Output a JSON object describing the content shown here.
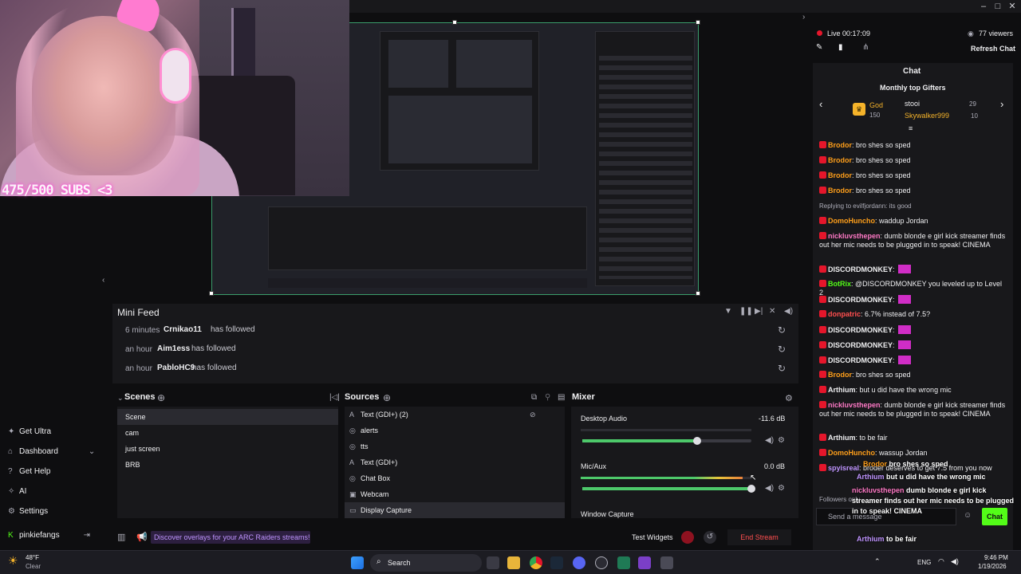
{
  "window": {
    "minimize": "–",
    "maximize": "□",
    "close": "✕"
  },
  "overlay": {
    "sub_goal": "475/500 SUBS <3"
  },
  "mini_feed": {
    "title": "Mini Feed",
    "items": [
      {
        "time": "6 minutes",
        "user": "Crnikao11",
        "action": "has followed"
      },
      {
        "time": "an hour",
        "user": "Aim1ess",
        "action": "has followed"
      },
      {
        "time": "an hour",
        "user": "PabloHC9",
        "action": "has followed"
      }
    ]
  },
  "left_nav": {
    "items": [
      {
        "label": "Get Ultra",
        "icon": "ultra-icon"
      },
      {
        "label": "Dashboard",
        "icon": "dashboard-icon"
      },
      {
        "label": "Get Help",
        "icon": "help-icon"
      },
      {
        "label": "AI",
        "icon": "ai-icon"
      },
      {
        "label": "Settings",
        "icon": "gear-icon"
      }
    ],
    "account": "pinkiefangs"
  },
  "scenes": {
    "title": "Scenes",
    "items": [
      "Scene",
      "cam",
      "just screen",
      "BRB"
    ],
    "active": 0
  },
  "sources": {
    "title": "Sources",
    "items": [
      "Text (GDI+) (2)",
      "alerts",
      "tts",
      "Text (GDI+)",
      "Chat Box",
      "Webcam",
      "Display Capture"
    ],
    "active": 6
  },
  "mixer": {
    "title": "Mixer",
    "channels": [
      {
        "name": "Desktop Audio",
        "db": "-11.6 dB",
        "level": 0.68,
        "meter": 0.0
      },
      {
        "name": "Mic/Aux",
        "db": "0.0 dB",
        "level": 1.0,
        "meter": 0.95
      },
      {
        "name": "Window Capture",
        "db": "",
        "level": 0.0,
        "meter": 0.0
      }
    ]
  },
  "bottom_bar": {
    "promo": "Discover overlays for your ARC Raiders streams!",
    "test_widgets": "Test Widgets",
    "end_stream": "End Stream"
  },
  "stream_status": {
    "live": "Live 00:17:09",
    "viewers": "77 viewers",
    "refresh_chat": "Refresh Chat"
  },
  "chat": {
    "title": "Chat",
    "gifters_title": "Monthly top Gifters",
    "gifters": [
      {
        "name": "God",
        "count": "150"
      },
      {
        "name": "stooi",
        "count": "29"
      },
      {
        "name": "Skywalker999",
        "count": "10"
      }
    ],
    "messages": [
      {
        "user": "Brodor",
        "text": ": bro shes so sped",
        "color": "#ff9f1a"
      },
      {
        "user": "Brodor",
        "text": ": bro shes so sped",
        "color": "#ff9f1a"
      },
      {
        "user": "Brodor",
        "text": ": bro shes so sped",
        "color": "#ff9f1a"
      },
      {
        "user": "Brodor",
        "text": ": bro shes so sped",
        "color": "#ff9f1a"
      },
      {
        "user": "",
        "text": "Replying to evilfjordann: its good",
        "color": "#adadb8"
      },
      {
        "user": "DomoHuncho",
        "text": ": waddup Jordan",
        "color": "#ff9f1a"
      },
      {
        "user": "nickluvsthepen",
        "text": ": dumb blonde e girl kick streamer finds out her mic needs to be plugged in to speak! CINEMA",
        "color": "#ff79c6"
      },
      {
        "user": "DISCORDMONKEY",
        "text": ":",
        "color": "#efeff1"
      },
      {
        "user": "BotRix",
        "text": ": @DISCORDMONKEY you leveled up to Level 2",
        "color": "#53fc18"
      },
      {
        "user": "DISCORDMONKEY",
        "text": ":",
        "color": "#efeff1"
      },
      {
        "user": "donpatric",
        "text": ": 6.7% instead of 7.5?",
        "color": "#ff4f4f"
      },
      {
        "user": "DISCORDMONKEY",
        "text": ":",
        "color": "#efeff1"
      },
      {
        "user": "DISCORDMONKEY",
        "text": ":",
        "color": "#efeff1"
      },
      {
        "user": "DISCORDMONKEY",
        "text": ":",
        "color": "#efeff1"
      },
      {
        "user": "Brodor",
        "text": ": bro shes so sped",
        "color": "#ff9f1a"
      },
      {
        "user": "Arthium",
        "text": ": but u did have the wrong mic",
        "color": "#efeff1"
      },
      {
        "user": "nickluvsthepen",
        "text": ": dumb blonde e girl kick streamer finds out her mic needs to be plugged in to speak! CINEMA",
        "color": "#ff79c6"
      },
      {
        "user": "Arthium",
        "text": ": to be fair",
        "color": "#efeff1"
      },
      {
        "user": "DomoHuncho",
        "text": ": wassup Jordan",
        "color": "#ff9f1a"
      },
      {
        "user": "spyisreal",
        "text": ": broder deserves to get 7.5 from you now",
        "color": "#bf94ff"
      }
    ],
    "followers_only": "Followers only",
    "input_placeholder": "Send a message",
    "send": "Chat"
  },
  "overlay_chat": [
    {
      "user": "Brodor",
      "text": "bro shes so sped"
    },
    {
      "user": "Arthium",
      "text": "but u did have the wrong mic"
    },
    {
      "user": "nickluvsthepen",
      "text": "dumb blonde e girl kick streamer finds out her mic needs to be plugged in to speak! CINEMA"
    },
    {
      "user": "Arthium",
      "text": "to be fair"
    },
    {
      "user": "spyisreal",
      "text": "broder deserves to get 7.5 from you flow"
    }
  ],
  "taskbar": {
    "weather_temp": "48°F",
    "weather_desc": "Clear",
    "search": "Search",
    "lang": "ENG",
    "time": "9:46 PM",
    "date": "1/19/2026"
  }
}
